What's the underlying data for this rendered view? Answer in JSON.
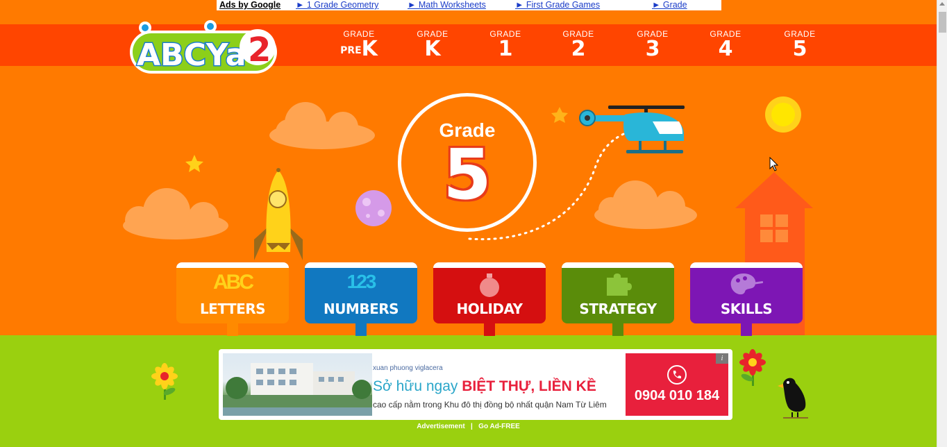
{
  "ad_bar": {
    "ads_by": "Ads by Google",
    "links": [
      "► 1 Grade Geometry",
      "► Math Worksheets",
      "► First Grade Games",
      "► Grade"
    ]
  },
  "logo": {
    "text": "ABCYa",
    "badge": "2"
  },
  "grades": [
    {
      "small": "GRADE",
      "pre": "PRE",
      "big": "K"
    },
    {
      "small": "GRADE",
      "pre": "",
      "big": "K"
    },
    {
      "small": "GRADE",
      "pre": "",
      "big": "1"
    },
    {
      "small": "GRADE",
      "pre": "",
      "big": "2"
    },
    {
      "small": "GRADE",
      "pre": "",
      "big": "3"
    },
    {
      "small": "GRADE",
      "pre": "",
      "big": "4"
    },
    {
      "small": "GRADE",
      "pre": "",
      "big": "5"
    }
  ],
  "hero": {
    "grade_word": "Grade",
    "grade_number": "5"
  },
  "categories": [
    {
      "label": "LETTERS",
      "icon": "abc-icon",
      "color": "#ff8a00",
      "icon_text": "ABC"
    },
    {
      "label": "NUMBERS",
      "icon": "123-icon",
      "color": "#1178c0",
      "icon_text": "123"
    },
    {
      "label": "HOLIDAY",
      "icon": "ornament-icon",
      "color": "#d50f10",
      "icon_text": ""
    },
    {
      "label": "STRATEGY",
      "icon": "puzzle-icon",
      "color": "#5a8c0a",
      "icon_text": ""
    },
    {
      "label": "SKILLS",
      "icon": "palette-icon",
      "color": "#7d16b4",
      "icon_text": ""
    }
  ],
  "ad": {
    "brand": "xuan phuong viglacera",
    "headline_a": "Sở hữu ngay",
    "headline_b": "BIỆT THỰ, LIỀN KỀ",
    "sub": "cao cấp nằm trong Khu đô thị đồng bộ nhất quận Nam Từ Liêm",
    "phone": "0904 010 184",
    "info": "i"
  },
  "ad_footer": {
    "advertisement": "Advertisement",
    "sep": "|",
    "go_ad_free": "Go Ad-FREE"
  },
  "colors": {
    "orange": "#ff7a00",
    "header": "#ff4500",
    "green": "#9ad00f"
  }
}
